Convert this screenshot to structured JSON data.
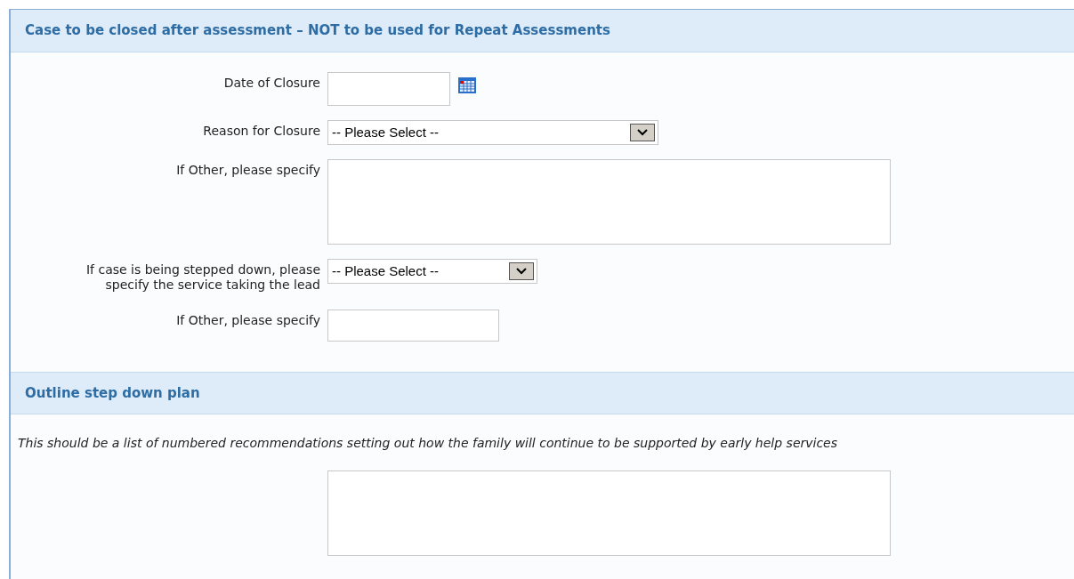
{
  "sections": [
    {
      "title": "Case to be closed after assessment – NOT to be used for Repeat Assessments",
      "fields": [
        {
          "kind": "date",
          "label": "Date of Closure"
        },
        {
          "kind": "select",
          "label": "Reason for Closure",
          "value": "-- Please Select --"
        },
        {
          "kind": "textarea",
          "label": "If Other, please specify"
        },
        {
          "kind": "select",
          "label": "If case is being stepped down, please specify the service taking the lead",
          "value": "-- Please Select --"
        },
        {
          "kind": "text",
          "label": "If Other, please specify"
        }
      ]
    },
    {
      "title": "Outline step down plan",
      "note": "This should be a list of numbered recommendations setting out how the family will continue to be supported by early help services",
      "fields": [
        {
          "kind": "textarea"
        }
      ]
    }
  ]
}
